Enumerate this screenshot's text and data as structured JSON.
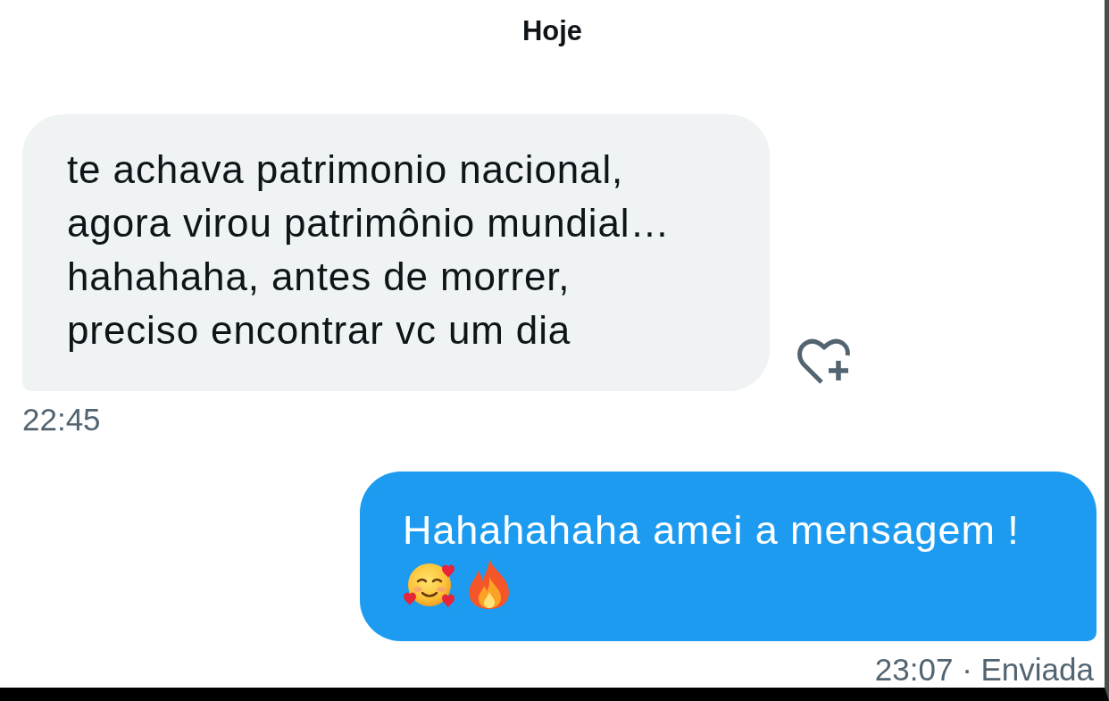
{
  "date_separator": "Hoje",
  "messages": [
    {
      "kind": "received",
      "text": "te achava patrimonio nacional,\nagora virou patrimônio mundial…\nhahahaha, antes de morrer,\npreciso encontrar vc um dia",
      "timestamp": "22:45"
    },
    {
      "kind": "sent",
      "text": "Hahahahaha amei a mensagem !",
      "timestamp": "23:07 · Enviada"
    }
  ]
}
